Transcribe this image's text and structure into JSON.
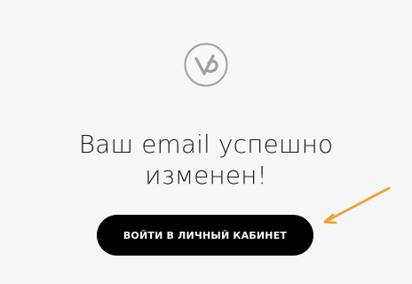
{
  "logo": {
    "icon": "v-logo-icon"
  },
  "message": {
    "line1": "Ваш email успешно",
    "line2": "изменен!"
  },
  "button": {
    "label": "ВОЙТИ В ЛИЧНЫЙ КАБИНЕТ"
  },
  "annotation": {
    "arrow_color": "#f0a030",
    "icon": "arrow-annotation-icon"
  }
}
